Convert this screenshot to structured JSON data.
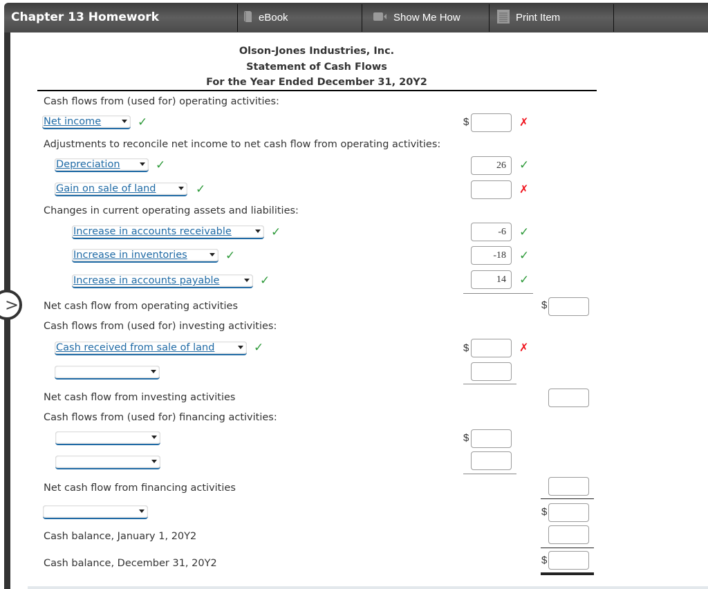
{
  "topbar": {
    "title": "Chapter 13 Homework",
    "ebook_label": "eBook",
    "ebook_icon": "book-icon",
    "show_me_how_label": "Show Me How",
    "show_me_how_icon": "video-camera-icon",
    "print_label": "Print Item",
    "print_icon": "document-icon",
    "bg_color": "#4a4a4a"
  },
  "nav": {
    "next_icon": "chevron-right-icon",
    "glyph": ">"
  },
  "statement": {
    "company": "Olson-Jones Industries, Inc.",
    "title": "Statement of Cash Flows",
    "period": "For the Year Ended December 31, 20Y2"
  },
  "operating": {
    "heading": "Cash flows from (used for) operating activities:",
    "net_income": {
      "selected": "Net income",
      "status": "correct",
      "amount": "",
      "amount_status": "incorrect"
    },
    "adjustments_heading": "Adjustments to reconcile net income to net cash flow from operating activities:",
    "depreciation": {
      "selected": "Depreciation",
      "status": "correct",
      "amount": "26",
      "amount_status": "correct"
    },
    "gain": {
      "selected": "Gain on sale of land",
      "status": "correct",
      "amount": "",
      "amount_status": "incorrect"
    },
    "changes_heading": "Changes in current operating assets and liabilities:",
    "ar": {
      "selected": "Increase in accounts receivable",
      "status": "correct",
      "amount": "-6",
      "amount_status": "correct"
    },
    "inv": {
      "selected": "Increase in inventories",
      "status": "correct",
      "amount": "-18",
      "amount_status": "correct"
    },
    "ap": {
      "selected": "Increase in accounts payable",
      "status": "correct",
      "amount": "14",
      "amount_status": "correct"
    },
    "net_label": "Net cash flow from operating activities",
    "net_amount": ""
  },
  "investing": {
    "heading": "Cash flows from (used for) investing activities:",
    "line1": {
      "selected": "Cash received from sale of land",
      "status": "correct",
      "amount": "",
      "amount_status": "incorrect"
    },
    "line2": {
      "selected": "",
      "amount": ""
    },
    "net_label": "Net cash flow from investing activities",
    "net_amount": ""
  },
  "financing": {
    "heading": "Cash flows from (used for) financing activities:",
    "line1": {
      "selected": "",
      "amount": ""
    },
    "line2": {
      "selected": "",
      "amount": ""
    },
    "net_label": "Net cash flow from financing activities",
    "net_amount": ""
  },
  "summary": {
    "change_select": "",
    "change_amount": "",
    "jan_label": "Cash balance, January 1, 20Y2",
    "jan_amount": "",
    "dec_label": "Cash balance, December 31, 20Y2",
    "dec_amount": ""
  },
  "symbols": {
    "dollar": "$",
    "check": "✓",
    "cross": "✗"
  },
  "colors": {
    "correct": "#2e9a3a",
    "incorrect": "#f0101a",
    "link_blue": "#1f6aa5"
  }
}
